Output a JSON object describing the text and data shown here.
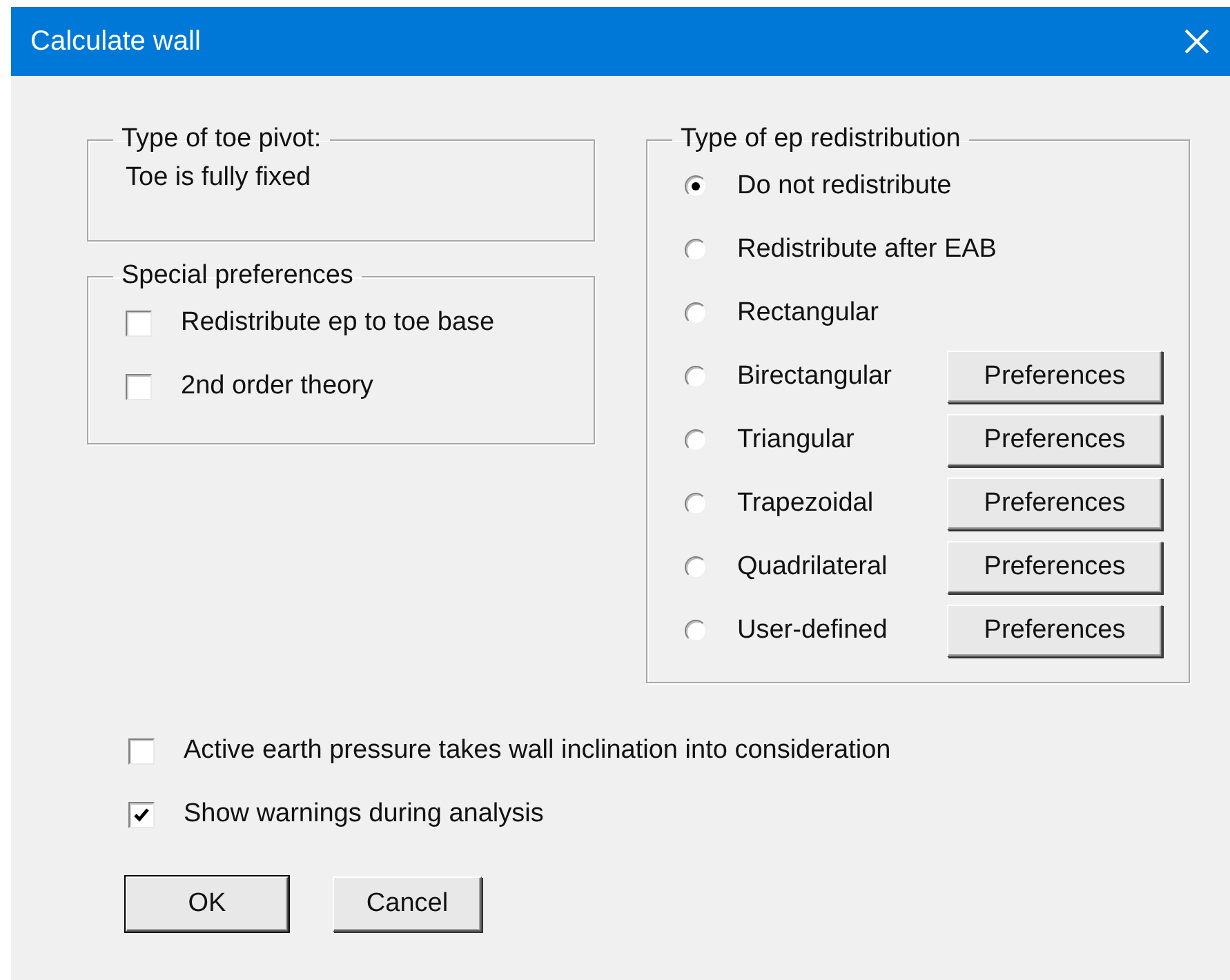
{
  "window": {
    "title": "Calculate wall"
  },
  "toe_pivot": {
    "title": "Type of toe pivot:",
    "value": "Toe is fully fixed"
  },
  "special_preferences": {
    "title": "Special preferences",
    "options": [
      {
        "label": "Redistribute ep to toe base",
        "checked": false
      },
      {
        "label": "2nd order theory",
        "checked": false
      }
    ]
  },
  "ep_redistribution": {
    "title": "Type of ep redistribution",
    "options": [
      {
        "label": "Do not redistribute",
        "selected": true
      },
      {
        "label": "Redistribute after EAB",
        "selected": false
      },
      {
        "label": "Rectangular",
        "selected": false
      },
      {
        "label": "Birectangular",
        "selected": false,
        "button": "Preferences"
      },
      {
        "label": "Triangular",
        "selected": false,
        "button": "Preferences"
      },
      {
        "label": "Trapezoidal",
        "selected": false,
        "button": "Preferences"
      },
      {
        "label": "Quadrilateral",
        "selected": false,
        "button": "Preferences"
      },
      {
        "label": "User-defined",
        "selected": false,
        "button": "Preferences"
      }
    ]
  },
  "options": [
    {
      "label": "Active earth pressure takes wall inclination into consideration",
      "checked": false
    },
    {
      "label": "Show warnings during analysis",
      "checked": true
    }
  ],
  "buttons": [
    {
      "label": "OK",
      "default": true
    },
    {
      "label": "Cancel",
      "default": false
    }
  ]
}
